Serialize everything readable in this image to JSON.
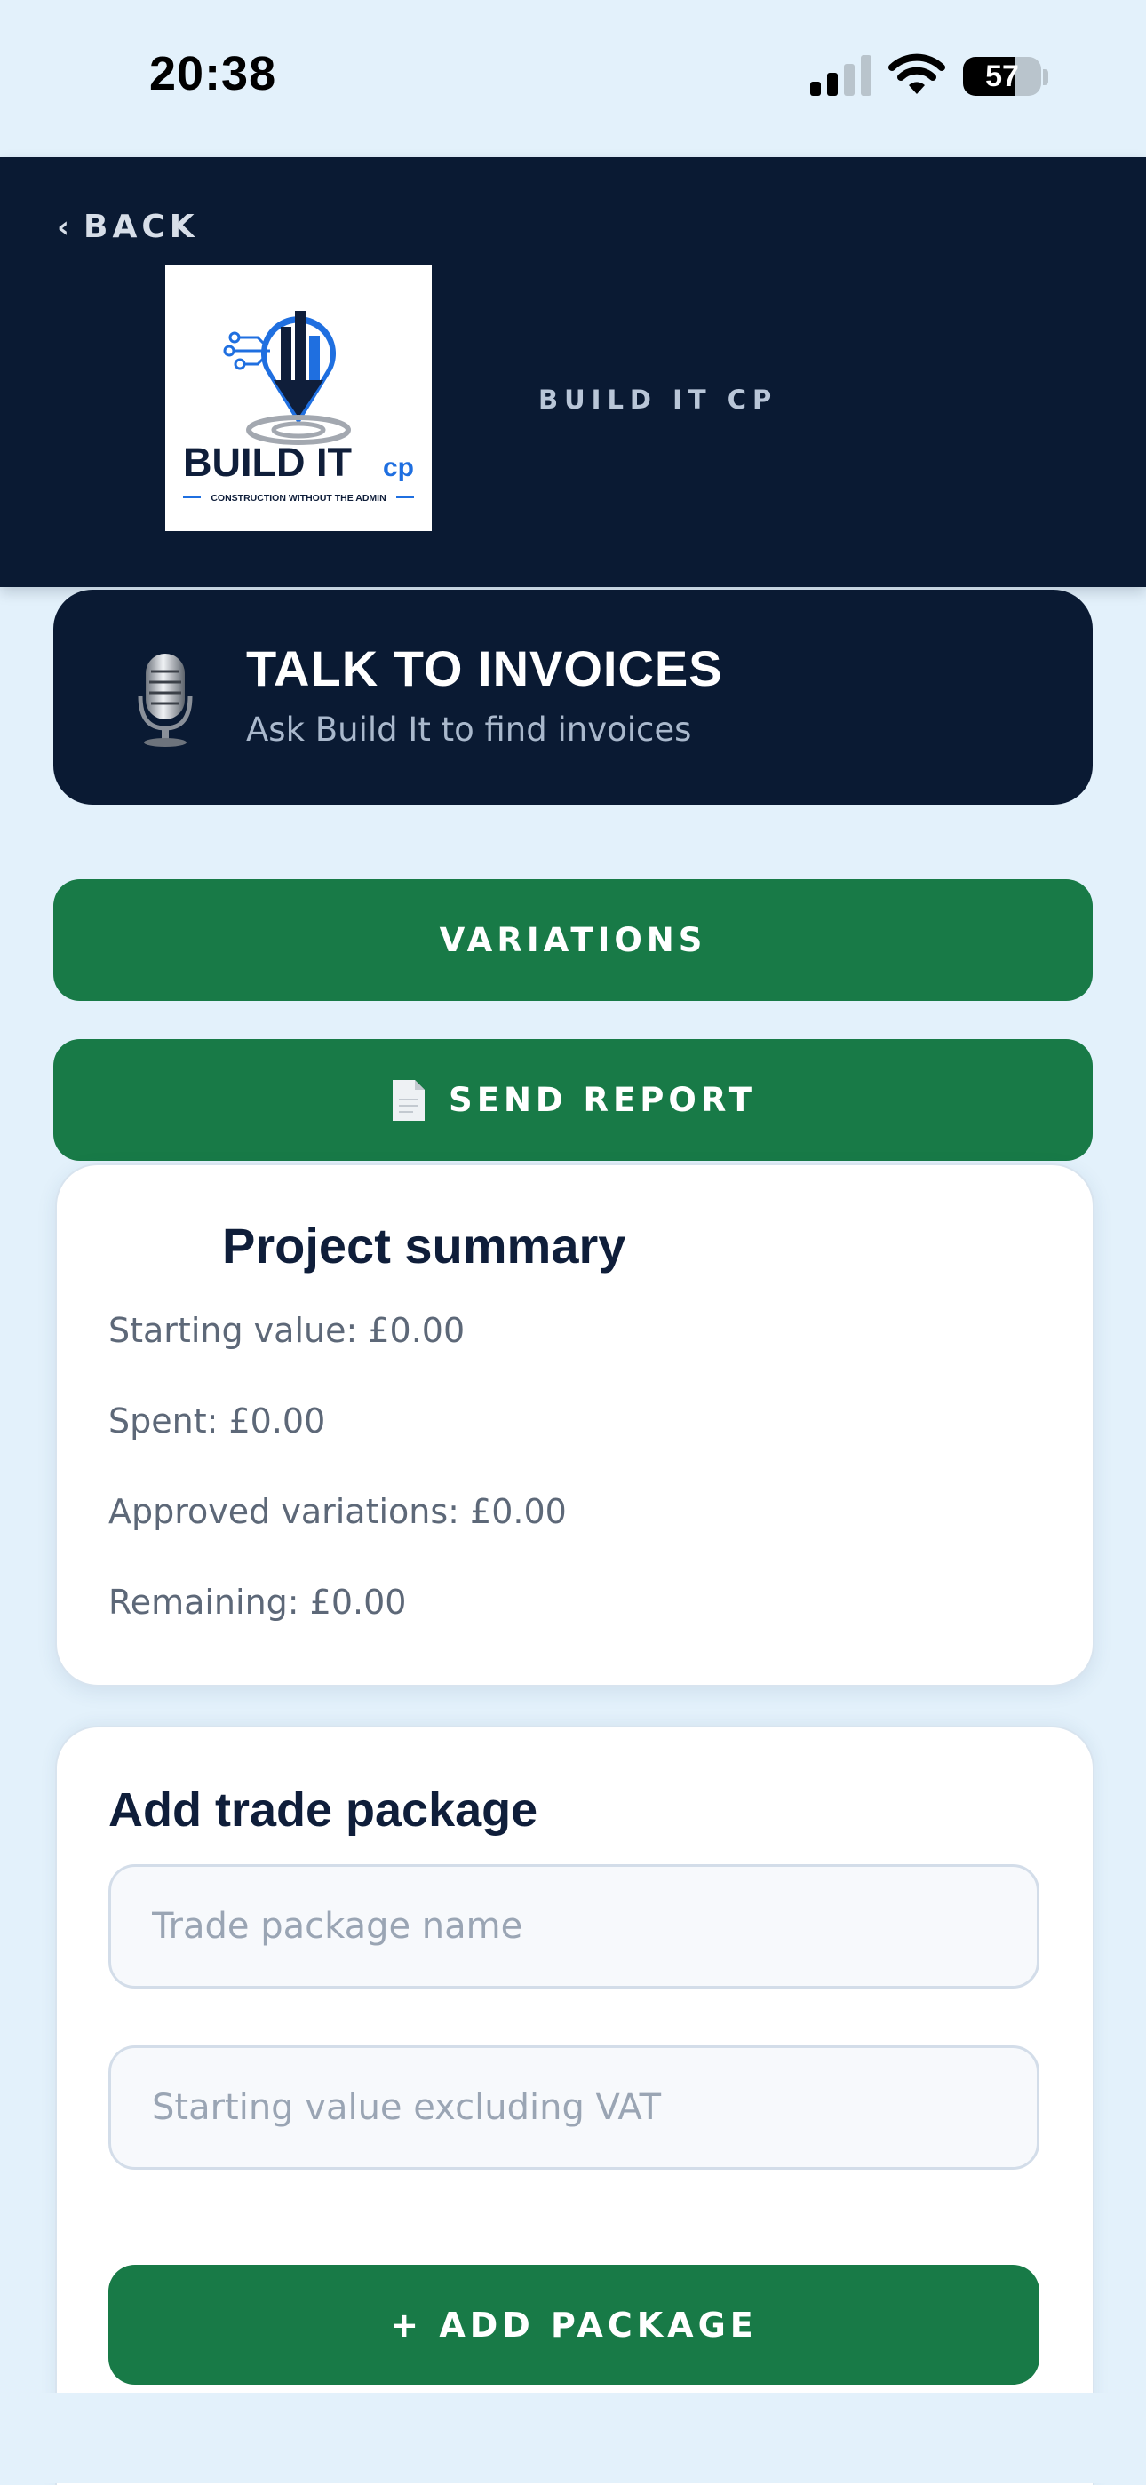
{
  "status_bar": {
    "time": "20:38",
    "battery_level": "57",
    "icons": [
      "signal-icon",
      "wifi-icon",
      "battery-icon"
    ]
  },
  "header": {
    "back_label": "BACK",
    "brand_name": "BUILD IT CP",
    "logo": {
      "wordmark_main": "BUILD IT",
      "wordmark_suffix": "cp",
      "tagline": "CONSTRUCTION WITHOUT THE ADMIN"
    }
  },
  "talk_card": {
    "title": "TALK TO INVOICES",
    "subtitle": "Ask Build It to find invoices",
    "icon": "microphone-icon"
  },
  "buttons": {
    "variations": "VARIATIONS",
    "send_report": "SEND REPORT",
    "send_report_icon": "document-icon"
  },
  "summary": {
    "title": "Project summary",
    "starting_value": "Starting value: £0.00",
    "spent": "Spent: £0.00",
    "approved_variations": "Approved variations: £0.00",
    "remaining": "Remaining: £0.00"
  },
  "add_package": {
    "title": "Add trade package",
    "name_placeholder": "Trade package name",
    "value_placeholder": "Starting value excluding VAT",
    "button_label": "+ ADD PACKAGE"
  },
  "colors": {
    "background": "#e3f1fb",
    "navy": "#0a1a33",
    "green": "#187a47",
    "brand_blue": "#1f6fe0"
  }
}
